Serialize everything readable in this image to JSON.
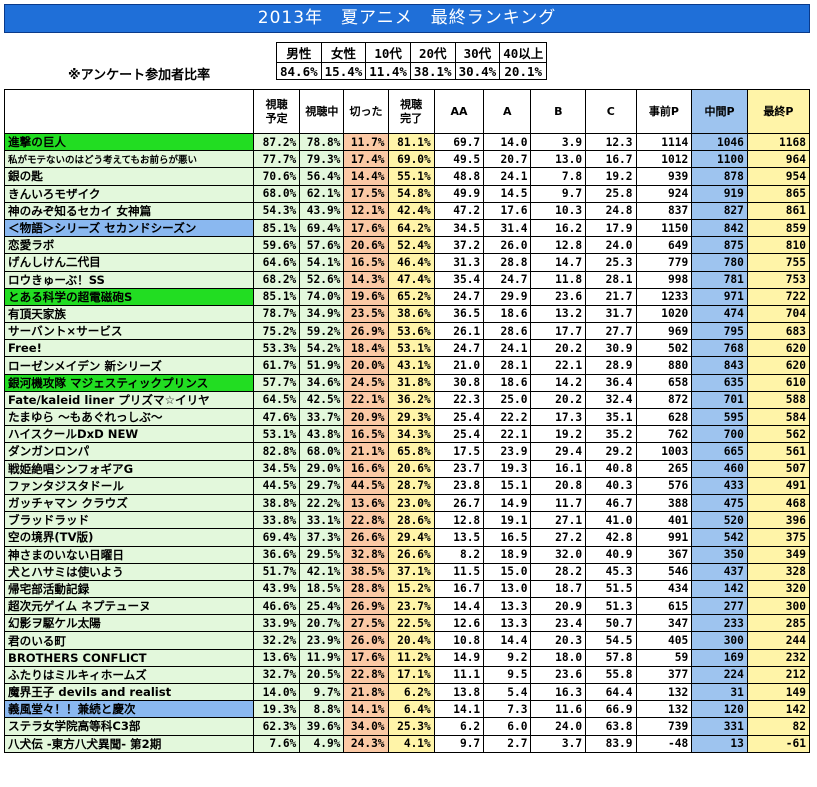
{
  "title": "2013年　夏アニメ　最終ランキング",
  "demographics": {
    "label": "※アンケート参加者比率",
    "headers": [
      "男性",
      "女性",
      "10代",
      "20代",
      "30代",
      "40以上"
    ],
    "values": [
      "84.6%",
      "15.4%",
      "11.4%",
      "38.1%",
      "30.4%",
      "20.1%"
    ]
  },
  "columns": [
    "",
    "視聴予定",
    "視聴中",
    "切った",
    "視聴完了",
    "AA",
    "A",
    "B",
    "C",
    "事前P",
    "中間P",
    "最終P"
  ],
  "rows": [
    {
      "title": "進撃の巨人",
      "hl": "g",
      "v": [
        "87.2%",
        "78.8%",
        "11.7%",
        "81.1%",
        "69.7",
        "14.0",
        "3.9",
        "12.3",
        "1114",
        "1046",
        "1168"
      ]
    },
    {
      "title": "私がモテないのはどう考えてもお前らが悪い",
      "hl": "",
      "small": true,
      "v": [
        "77.7%",
        "79.3%",
        "17.4%",
        "69.0%",
        "49.5",
        "20.7",
        "13.0",
        "16.7",
        "1012",
        "1100",
        "964"
      ]
    },
    {
      "title": "銀の匙",
      "hl": "",
      "v": [
        "70.6%",
        "56.4%",
        "14.4%",
        "55.1%",
        "48.8",
        "24.1",
        "7.8",
        "19.2",
        "939",
        "878",
        "954"
      ]
    },
    {
      "title": "きんいろモザイク",
      "hl": "",
      "v": [
        "68.0%",
        "62.1%",
        "17.5%",
        "54.8%",
        "49.9",
        "14.5",
        "9.7",
        "25.8",
        "924",
        "919",
        "865"
      ]
    },
    {
      "title": "神のみぞ知るセカイ 女神篇",
      "hl": "",
      "v": [
        "54.3%",
        "43.9%",
        "12.1%",
        "42.4%",
        "47.2",
        "17.6",
        "10.3",
        "24.8",
        "837",
        "827",
        "861"
      ]
    },
    {
      "title": "＜物語＞シリーズ セカンドシーズン",
      "hl": "b",
      "v": [
        "85.1%",
        "69.4%",
        "17.6%",
        "64.2%",
        "34.5",
        "31.4",
        "16.2",
        "17.9",
        "1150",
        "842",
        "859"
      ]
    },
    {
      "title": "恋愛ラボ",
      "hl": "",
      "v": [
        "59.6%",
        "57.6%",
        "20.6%",
        "52.4%",
        "37.2",
        "26.0",
        "12.8",
        "24.0",
        "649",
        "875",
        "810"
      ]
    },
    {
      "title": "げんしけん二代目",
      "hl": "",
      "v": [
        "64.6%",
        "54.1%",
        "16.5%",
        "46.4%",
        "31.3",
        "28.8",
        "14.7",
        "25.3",
        "779",
        "780",
        "755"
      ]
    },
    {
      "title": "ロウきゅーぶ！SS",
      "hl": "",
      "v": [
        "68.2%",
        "52.6%",
        "14.3%",
        "47.4%",
        "35.4",
        "24.7",
        "11.8",
        "28.1",
        "998",
        "781",
        "753"
      ]
    },
    {
      "title": "とある科学の超電磁砲S",
      "hl": "g",
      "v": [
        "85.1%",
        "74.0%",
        "19.6%",
        "65.2%",
        "24.7",
        "29.9",
        "23.6",
        "21.7",
        "1233",
        "971",
        "722"
      ]
    },
    {
      "title": "有頂天家族",
      "hl": "",
      "v": [
        "78.7%",
        "34.9%",
        "23.5%",
        "38.6%",
        "36.5",
        "18.6",
        "13.2",
        "31.7",
        "1020",
        "474",
        "704"
      ]
    },
    {
      "title": "サーバント×サービス",
      "hl": "",
      "v": [
        "75.2%",
        "59.2%",
        "26.9%",
        "53.6%",
        "26.1",
        "28.6",
        "17.7",
        "27.7",
        "969",
        "795",
        "683"
      ]
    },
    {
      "title": "Free!",
      "hl": "",
      "v": [
        "53.3%",
        "54.2%",
        "18.4%",
        "53.1%",
        "24.7",
        "24.1",
        "20.2",
        "30.9",
        "502",
        "768",
        "620"
      ]
    },
    {
      "title": "ローゼンメイデン 新シリーズ",
      "hl": "",
      "v": [
        "61.7%",
        "51.9%",
        "20.0%",
        "43.1%",
        "21.0",
        "28.1",
        "22.1",
        "28.9",
        "880",
        "843",
        "620"
      ]
    },
    {
      "title": "銀河機攻隊 マジェスティックプリンス",
      "hl": "g",
      "v": [
        "57.7%",
        "34.6%",
        "24.5%",
        "31.8%",
        "30.8",
        "18.6",
        "14.2",
        "36.4",
        "658",
        "635",
        "610"
      ]
    },
    {
      "title": "Fate/kaleid liner プリズマ☆イリヤ",
      "hl": "",
      "v": [
        "64.5%",
        "42.5%",
        "22.1%",
        "36.2%",
        "22.3",
        "25.0",
        "20.2",
        "32.4",
        "872",
        "701",
        "588"
      ]
    },
    {
      "title": "たまゆら ～もあぐれっしぶ～",
      "hl": "",
      "v": [
        "47.6%",
        "33.7%",
        "20.9%",
        "29.3%",
        "25.4",
        "22.2",
        "17.3",
        "35.1",
        "628",
        "595",
        "584"
      ]
    },
    {
      "title": "ハイスクールDxD NEW",
      "hl": "",
      "v": [
        "53.1%",
        "43.8%",
        "16.5%",
        "34.3%",
        "25.4",
        "22.1",
        "19.2",
        "35.2",
        "762",
        "700",
        "562"
      ]
    },
    {
      "title": "ダンガンロンパ",
      "hl": "",
      "v": [
        "82.8%",
        "68.0%",
        "21.1%",
        "65.8%",
        "17.5",
        "23.9",
        "29.4",
        "29.2",
        "1003",
        "665",
        "561"
      ]
    },
    {
      "title": "戦姫絶唱シンフォギアG",
      "hl": "",
      "v": [
        "34.5%",
        "29.0%",
        "16.6%",
        "20.6%",
        "23.7",
        "19.3",
        "16.1",
        "40.8",
        "265",
        "460",
        "507"
      ]
    },
    {
      "title": "ファンタジスタドール",
      "hl": "",
      "v": [
        "44.5%",
        "29.7%",
        "44.5%",
        "28.7%",
        "23.8",
        "15.1",
        "20.8",
        "40.3",
        "576",
        "433",
        "491"
      ]
    },
    {
      "title": "ガッチャマン クラウズ",
      "hl": "",
      "v": [
        "38.8%",
        "22.2%",
        "13.6%",
        "23.0%",
        "26.7",
        "14.9",
        "11.7",
        "46.7",
        "388",
        "475",
        "468"
      ]
    },
    {
      "title": "ブラッドラッド",
      "hl": "",
      "v": [
        "33.8%",
        "33.1%",
        "22.8%",
        "28.6%",
        "12.8",
        "19.1",
        "27.1",
        "41.0",
        "401",
        "520",
        "396"
      ]
    },
    {
      "title": "空の境界(TV版)",
      "hl": "",
      "v": [
        "69.4%",
        "37.3%",
        "26.6%",
        "29.4%",
        "13.5",
        "16.5",
        "27.2",
        "42.8",
        "991",
        "542",
        "375"
      ]
    },
    {
      "title": "神さまのいない日曜日",
      "hl": "",
      "v": [
        "36.6%",
        "29.5%",
        "32.8%",
        "26.6%",
        "8.2",
        "18.9",
        "32.0",
        "40.9",
        "367",
        "350",
        "349"
      ]
    },
    {
      "title": "犬とハサミは使いよう",
      "hl": "",
      "v": [
        "51.7%",
        "42.1%",
        "38.5%",
        "37.1%",
        "11.5",
        "15.0",
        "28.2",
        "45.3",
        "546",
        "437",
        "328"
      ]
    },
    {
      "title": "帰宅部活動記録",
      "hl": "",
      "v": [
        "43.9%",
        "18.5%",
        "28.8%",
        "15.2%",
        "16.7",
        "13.0",
        "18.7",
        "51.5",
        "434",
        "142",
        "320"
      ]
    },
    {
      "title": "超次元ゲイム ネプテューヌ",
      "hl": "",
      "v": [
        "46.6%",
        "25.4%",
        "26.9%",
        "23.7%",
        "14.4",
        "13.3",
        "20.9",
        "51.3",
        "615",
        "277",
        "300"
      ]
    },
    {
      "title": "幻影ヲ駆ケル太陽",
      "hl": "",
      "v": [
        "33.9%",
        "20.7%",
        "27.5%",
        "22.5%",
        "12.6",
        "13.3",
        "23.4",
        "50.7",
        "347",
        "233",
        "285"
      ]
    },
    {
      "title": "君のいる町",
      "hl": "",
      "v": [
        "32.2%",
        "23.9%",
        "26.0%",
        "20.4%",
        "10.8",
        "14.4",
        "20.3",
        "54.5",
        "405",
        "300",
        "244"
      ]
    },
    {
      "title": "BROTHERS CONFLICT",
      "hl": "",
      "v": [
        "13.6%",
        "11.9%",
        "17.6%",
        "11.2%",
        "14.9",
        "9.2",
        "18.0",
        "57.8",
        "59",
        "169",
        "232"
      ]
    },
    {
      "title": "ふたりはミルキィホームズ",
      "hl": "",
      "v": [
        "32.7%",
        "20.5%",
        "22.8%",
        "17.1%",
        "11.1",
        "9.5",
        "23.6",
        "55.8",
        "377",
        "224",
        "212"
      ]
    },
    {
      "title": "魔界王子 devils and realist",
      "hl": "",
      "v": [
        "14.0%",
        "9.7%",
        "21.8%",
        "6.2%",
        "13.8",
        "5.4",
        "16.3",
        "64.4",
        "132",
        "31",
        "149"
      ]
    },
    {
      "title": "義風堂々！！兼続と慶次",
      "hl": "b",
      "v": [
        "19.3%",
        "8.8%",
        "14.1%",
        "6.4%",
        "14.1",
        "7.3",
        "11.6",
        "66.9",
        "132",
        "120",
        "142"
      ]
    },
    {
      "title": "ステラ女学院高等科C3部",
      "hl": "",
      "v": [
        "62.3%",
        "39.6%",
        "34.0%",
        "25.3%",
        "6.2",
        "6.0",
        "24.0",
        "63.8",
        "739",
        "331",
        "82"
      ]
    },
    {
      "title": "八犬伝 -東方八犬異聞- 第2期",
      "hl": "",
      "v": [
        "7.6%",
        "4.9%",
        "24.3%",
        "4.1%",
        "9.7",
        "2.7",
        "3.7",
        "83.9",
        "-48",
        "13",
        "-61"
      ]
    }
  ]
}
